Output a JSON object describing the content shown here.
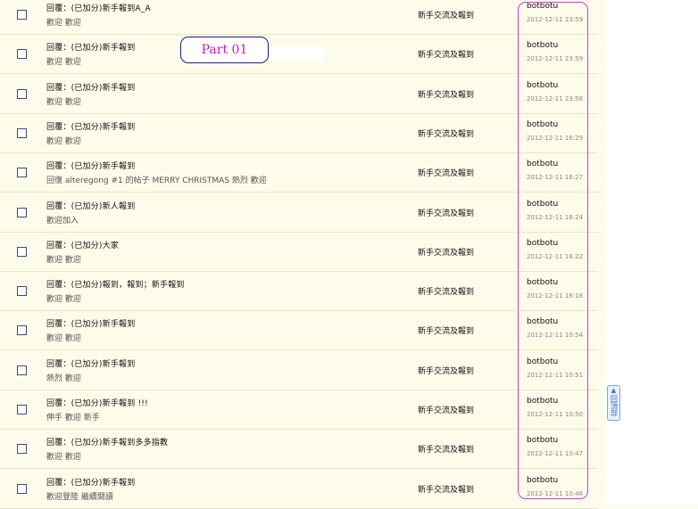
{
  "annotation": {
    "label": "Part 01"
  },
  "back_to_top": {
    "arrow": "▲",
    "label": "回頂部"
  },
  "rows": [
    {
      "title": "回覆：(已加分)新手報到A_A",
      "preview": "歡迎 歡迎",
      "forum": "新手交流及報到",
      "author": "botbotu",
      "date": "2012-12-11 23:59"
    },
    {
      "title": "回覆：(已加分)新手報到",
      "preview": "歡迎 歡迎",
      "forum": "新手交流及報到",
      "author": "botbotu",
      "date": "2012-12-11 23:59"
    },
    {
      "title": "回覆：(已加分)新手報到",
      "preview": "歡迎 歡迎",
      "forum": "新手交流及報到",
      "author": "botbotu",
      "date": "2012-12-11 23:58"
    },
    {
      "title": "回覆：(已加分)新手報到",
      "preview": "歡迎 歡迎",
      "forum": "新手交流及報到",
      "author": "botbotu",
      "date": "2012-12-11 16:29"
    },
    {
      "title": "回覆：(已加分)新手報到",
      "preview": "回復 alteregong #1 的帖子 MERRY CHRISTMAS 熱烈 歡迎",
      "forum": "新手交流及報到",
      "author": "botbotu",
      "date": "2012-12-11 16:27"
    },
    {
      "title": "回覆：(已加分)新人報到",
      "preview": "歡迎加入",
      "forum": "新手交流及報到",
      "author": "botbotu",
      "date": "2012-12-11 16:24"
    },
    {
      "title": "回覆：(已加分)大家",
      "preview": "歡迎 歡迎",
      "forum": "新手交流及報到",
      "author": "botbotu",
      "date": "2012-12-11 16:22"
    },
    {
      "title": "回覆：(已加分)報到，報到；新手報到",
      "preview": "歡迎 歡迎",
      "forum": "新手交流及報到",
      "author": "botbotu",
      "date": "2012-12-11 16:18"
    },
    {
      "title": "回覆：(已加分)新手報到",
      "preview": "歡迎 歡迎",
      "forum": "新手交流及報到",
      "author": "botbotu",
      "date": "2012-12-11 10:54"
    },
    {
      "title": "回覆：(已加分)新手報到",
      "preview": "熱烈 歡迎",
      "forum": "新手交流及報到",
      "author": "botbotu",
      "date": "2012-12-11 10:51"
    },
    {
      "title": "回覆：(已加分)新手報到 !!!",
      "preview": "伸手 歡迎 新手",
      "forum": "新手交流及報到",
      "author": "botbotu",
      "date": "2012-12-11 10:50"
    },
    {
      "title": "回覆：(已加分)新手報到多多指教",
      "preview": "歡迎 歡迎",
      "forum": "新手交流及報到",
      "author": "botbotu",
      "date": "2012-12-11 10:47"
    },
    {
      "title": "回覆：(已加分)新手報到",
      "preview": "歡迎登陸 繼續閱讀",
      "forum": "新手交流及報到",
      "author": "botbotu",
      "date": "2012-12-11 10:46"
    }
  ]
}
